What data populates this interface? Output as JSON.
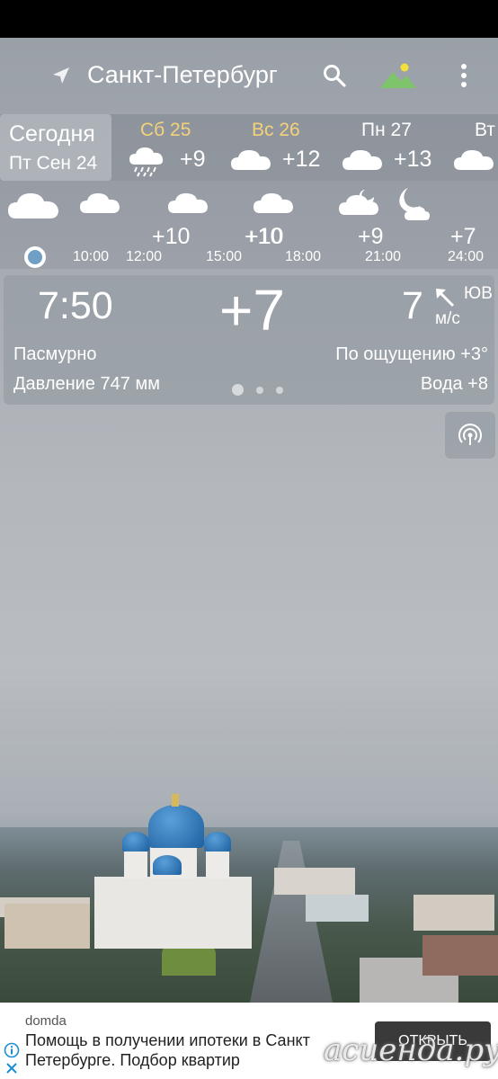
{
  "header": {
    "city": "Санкт-Петербург"
  },
  "today": {
    "label": "Сегодня",
    "date": "Пт Сен 24"
  },
  "days": [
    {
      "name": "Сб 25",
      "temp": "+9",
      "icon": "rain-cloud-icon",
      "weekend": true
    },
    {
      "name": "Вс 26",
      "temp": "+12",
      "icon": "cloud-icon",
      "weekend": true
    },
    {
      "name": "Пн 27",
      "temp": "+13",
      "icon": "cloud-icon",
      "weekend": false
    },
    {
      "name": "Вт",
      "temp": "",
      "icon": "cloud-icon",
      "weekend": false
    }
  ],
  "hours": [
    {
      "time": "10:00",
      "temp": "",
      "icon": "cloud-icon"
    },
    {
      "time": "12:00",
      "temp": "+10",
      "icon": "cloud-icon"
    },
    {
      "time": "15:00",
      "temp": "+10",
      "icon": "cloud-icon"
    },
    {
      "time": "18:00",
      "temp": "+10",
      "icon": "cloud-icon"
    },
    {
      "time": "21:00",
      "temp": "+9",
      "icon": "night-cloud-icon"
    },
    {
      "time": "24:00",
      "temp": "+7",
      "icon": "moon-cloud-icon"
    }
  ],
  "current": {
    "time": "7:50",
    "temp": "+7",
    "wind_speed": "7",
    "wind_dir": "ЮВ",
    "wind_unit": "м/с",
    "condition": "Пасмурно",
    "feels_like": "По ощущению +3°",
    "pressure": "Давление 747 мм",
    "water": "Вода +8"
  },
  "ad": {
    "advertiser": "domda",
    "text": "Помощь в получении ипотеки в Санкт Петербурге. Подбор квартир",
    "cta": "ОТКРЫТЬ"
  },
  "watermark": "асиенда.ру",
  "colors": {
    "weekend": "#f3d27a",
    "now_dot": "#6f9fc4",
    "ad_button": "#3a3a3a"
  }
}
